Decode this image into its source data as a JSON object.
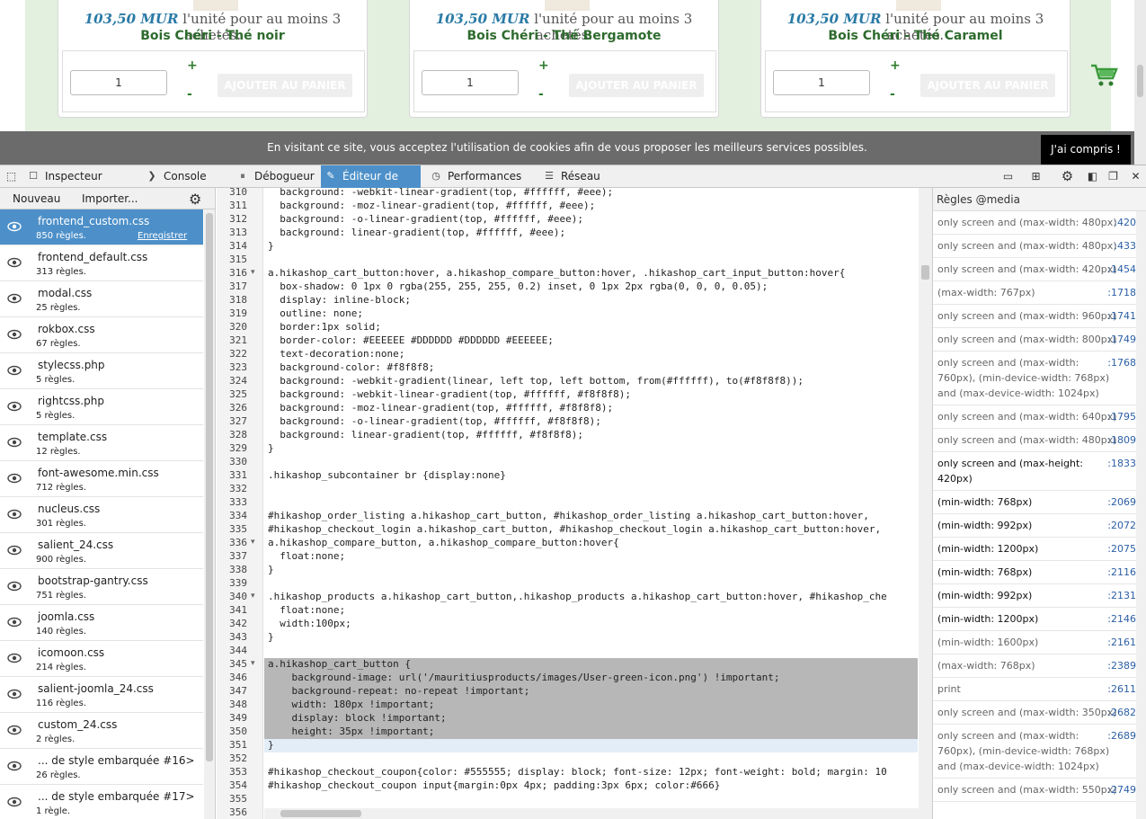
{
  "page": {
    "products": [
      {
        "price": "103,50 MUR",
        "price_suffix": "l'unité pour au moins 3 achetés.",
        "name": "Bois Chéri - Thé noir",
        "qty": "1",
        "plus": "+",
        "minus": "-",
        "add_label": "AJOUTER AU PANIER"
      },
      {
        "price": "103,50 MUR",
        "price_suffix": "l'unité pour au moins 3 achetés.",
        "name": "Bois Chéri - Thé Bergamote",
        "qty": "1",
        "plus": "+",
        "minus": "-",
        "add_label": "AJOUTER AU PANIER"
      },
      {
        "price": "103,50 MUR",
        "price_suffix": "l'unité pour au moins 3 achetés.",
        "name": "Bois Chéri - Thé Caramel",
        "qty": "1",
        "plus": "+",
        "minus": "-",
        "add_label": "AJOUTER AU PANIER"
      }
    ],
    "cookie_text": "En visitant ce site, vous acceptez l'utilisation de cookies afin de vous proposer les meilleurs services possibles.",
    "cookie_button": "J'ai compris !"
  },
  "toolbar": {
    "tabs": [
      "Inspecteur",
      "Console",
      "Débogueur",
      "Éditeur de st...",
      "Performances",
      "Réseau"
    ],
    "icons": [
      "pick-element-icon",
      "inspector-icon",
      "console-icon",
      "debugger-icon",
      "style-editor-icon",
      "performance-icon",
      "network-icon",
      "split-console-icon",
      "responsive-icon",
      "settings-icon",
      "dock-side-icon",
      "separate-window-icon",
      "close-icon"
    ]
  },
  "stylesheets": {
    "new_label": "Nouveau",
    "import_label": "Importer...",
    "save_label": "Enregistrer",
    "items": [
      {
        "name": "frontend_custom.css",
        "count": "850 règles."
      },
      {
        "name": "frontend_default.css",
        "count": "313 règles."
      },
      {
        "name": "modal.css",
        "count": "25 règles."
      },
      {
        "name": "rokbox.css",
        "count": "67 règles."
      },
      {
        "name": "stylecss.php",
        "count": "5 règles."
      },
      {
        "name": "rightcss.php",
        "count": "5 règles."
      },
      {
        "name": "template.css",
        "count": "12 règles."
      },
      {
        "name": "font-awesome.min.css",
        "count": "712 règles."
      },
      {
        "name": "nucleus.css",
        "count": "301 règles."
      },
      {
        "name": "salient_24.css",
        "count": "900 règles."
      },
      {
        "name": "bootstrap-gantry.css",
        "count": "751 règles."
      },
      {
        "name": "joomla.css",
        "count": "140 règles."
      },
      {
        "name": "icomoon.css",
        "count": "214 règles."
      },
      {
        "name": "salient-joomla_24.css",
        "count": "116 règles."
      },
      {
        "name": "custom_24.css",
        "count": "2 règles."
      },
      {
        "name": "... de style embarquée #16>",
        "count": "26 règles."
      },
      {
        "name": "... de style embarquée #17>",
        "count": "1 règle."
      }
    ]
  },
  "editor": {
    "lines": [
      {
        "n": "310",
        "t": "  background: -webkit-linear-gradient(top, #ffffff, #eee);"
      },
      {
        "n": "311",
        "t": "  background: -moz-linear-gradient(top, #ffffff, #eee);"
      },
      {
        "n": "312",
        "t": "  background: -o-linear-gradient(top, #ffffff, #eee);"
      },
      {
        "n": "313",
        "t": "  background: linear-gradient(top, #ffffff, #eee);"
      },
      {
        "n": "314",
        "t": "}"
      },
      {
        "n": "315",
        "t": ""
      },
      {
        "n": "316",
        "t": "a.hikashop_cart_button:hover, a.hikashop_compare_button:hover, .hikashop_cart_input_button:hover{"
      },
      {
        "n": "317",
        "t": "  box-shadow: 0 1px 0 rgba(255, 255, 255, 0.2) inset, 0 1px 2px rgba(0, 0, 0, 0.05);"
      },
      {
        "n": "318",
        "t": "  display: inline-block;"
      },
      {
        "n": "319",
        "t": "  outline: none;"
      },
      {
        "n": "320",
        "t": "  border:1px solid;"
      },
      {
        "n": "321",
        "t": "  border-color: #EEEEEE #DDDDDD #DDDDDD #EEEEEE;"
      },
      {
        "n": "322",
        "t": "  text-decoration:none;"
      },
      {
        "n": "323",
        "t": "  background-color: #f8f8f8;"
      },
      {
        "n": "324",
        "t": "  background: -webkit-gradient(linear, left top, left bottom, from(#ffffff), to(#f8f8f8));"
      },
      {
        "n": "325",
        "t": "  background: -webkit-linear-gradient(top, #ffffff, #f8f8f8);"
      },
      {
        "n": "326",
        "t": "  background: -moz-linear-gradient(top, #ffffff, #f8f8f8);"
      },
      {
        "n": "327",
        "t": "  background: -o-linear-gradient(top, #ffffff, #f8f8f8);"
      },
      {
        "n": "328",
        "t": "  background: linear-gradient(top, #ffffff, #f8f8f8);"
      },
      {
        "n": "329",
        "t": "}"
      },
      {
        "n": "330",
        "t": ""
      },
      {
        "n": "331",
        "t": ".hikashop_subcontainer br {display:none}"
      },
      {
        "n": "332",
        "t": ""
      },
      {
        "n": "333",
        "t": ""
      },
      {
        "n": "334",
        "t": "#hikashop_order_listing a.hikashop_cart_button, #hikashop_order_listing a.hikashop_cart_button:hover,"
      },
      {
        "n": "335",
        "t": "#hikashop_checkout_login a.hikashop_cart_button, #hikashop_checkout_login a.hikashop_cart_button:hover,"
      },
      {
        "n": "336",
        "t": "a.hikashop_compare_button, a.hikashop_compare_button:hover{"
      },
      {
        "n": "337",
        "t": "  float:none;"
      },
      {
        "n": "338",
        "t": "}"
      },
      {
        "n": "339",
        "t": ""
      },
      {
        "n": "340",
        "t": ".hikashop_products a.hikashop_cart_button,.hikashop_products a.hikashop_cart_button:hover, #hikashop_che"
      },
      {
        "n": "341",
        "t": "  float:none;"
      },
      {
        "n": "342",
        "t": "  width:100px;"
      },
      {
        "n": "343",
        "t": "}"
      },
      {
        "n": "344",
        "t": ""
      },
      {
        "n": "345",
        "t": "a.hikashop_cart_button {"
      },
      {
        "n": "346",
        "t": "    background-image: url('/mauritiusproducts/images/User-green-icon.png') !important;"
      },
      {
        "n": "347",
        "t": "    background-repeat: no-repeat !important;"
      },
      {
        "n": "348",
        "t": "    width: 180px !important;"
      },
      {
        "n": "349",
        "t": "    display: block !important;"
      },
      {
        "n": "350",
        "t": "    height: 35px !important;"
      },
      {
        "n": "351",
        "t": "}"
      },
      {
        "n": "352",
        "t": ""
      },
      {
        "n": "353",
        "t": "#hikashop_checkout_coupon{color: #555555; display: block; font-size: 12px; font-weight: bold; margin: 10"
      },
      {
        "n": "354",
        "t": "#hikashop_checkout_coupon input{margin:0px 4px; padding:3px 6px; color:#666}"
      },
      {
        "n": "355",
        "t": ""
      },
      {
        "n": "356",
        "t": ""
      }
    ]
  },
  "media": {
    "header": "Règles @media",
    "rules": [
      {
        "q": "only screen and (max-width: 480px)",
        "l": ":420",
        "on": false
      },
      {
        "q": "only screen and (max-width: 480px)",
        "l": ":433",
        "on": false
      },
      {
        "q": "only screen and (max-width: 420px)",
        "l": ":1454",
        "on": false
      },
      {
        "q": "(max-width: 767px)",
        "l": ":1718",
        "on": false
      },
      {
        "q": "only screen and (max-width: 960px)",
        "l": ":1741",
        "on": false
      },
      {
        "q": "only screen and (max-width: 800px)",
        "l": ":1749",
        "on": false
      },
      {
        "q": "only screen and (max-width: 760px), (min-device-width: 768px) and (max-device-width: 1024px)",
        "l": ":1768",
        "on": false
      },
      {
        "q": "only screen and (max-width: 640px)",
        "l": ":1795",
        "on": false
      },
      {
        "q": "only screen and (max-width: 480px)",
        "l": ":1809",
        "on": false
      },
      {
        "q": "only screen and (max-height: 420px)",
        "l": ":1833",
        "on": true
      },
      {
        "q": "(min-width: 768px)",
        "l": ":2069",
        "on": true
      },
      {
        "q": "(min-width: 992px)",
        "l": ":2072",
        "on": true
      },
      {
        "q": "(min-width: 1200px)",
        "l": ":2075",
        "on": true
      },
      {
        "q": "(min-width: 768px)",
        "l": ":2116",
        "on": true
      },
      {
        "q": "(min-width: 992px)",
        "l": ":2131",
        "on": true
      },
      {
        "q": "(min-width: 1200px)",
        "l": ":2146",
        "on": true
      },
      {
        "q": "(min-width: 1600px)",
        "l": ":2161",
        "on": false
      },
      {
        "q": "(max-width: 768px)",
        "l": ":2389",
        "on": false
      },
      {
        "q": "print",
        "l": ":2611",
        "on": false
      },
      {
        "q": "only screen and (max-width: 350px)",
        "l": ":2682",
        "on": false
      },
      {
        "q": "only screen and (max-width: 760px), (min-device-width: 768px) and (max-device-width: 1024px)",
        "l": ":2689",
        "on": false
      },
      {
        "q": "only screen and (max-width: 550px)",
        "l": ":2749",
        "on": false
      }
    ]
  }
}
